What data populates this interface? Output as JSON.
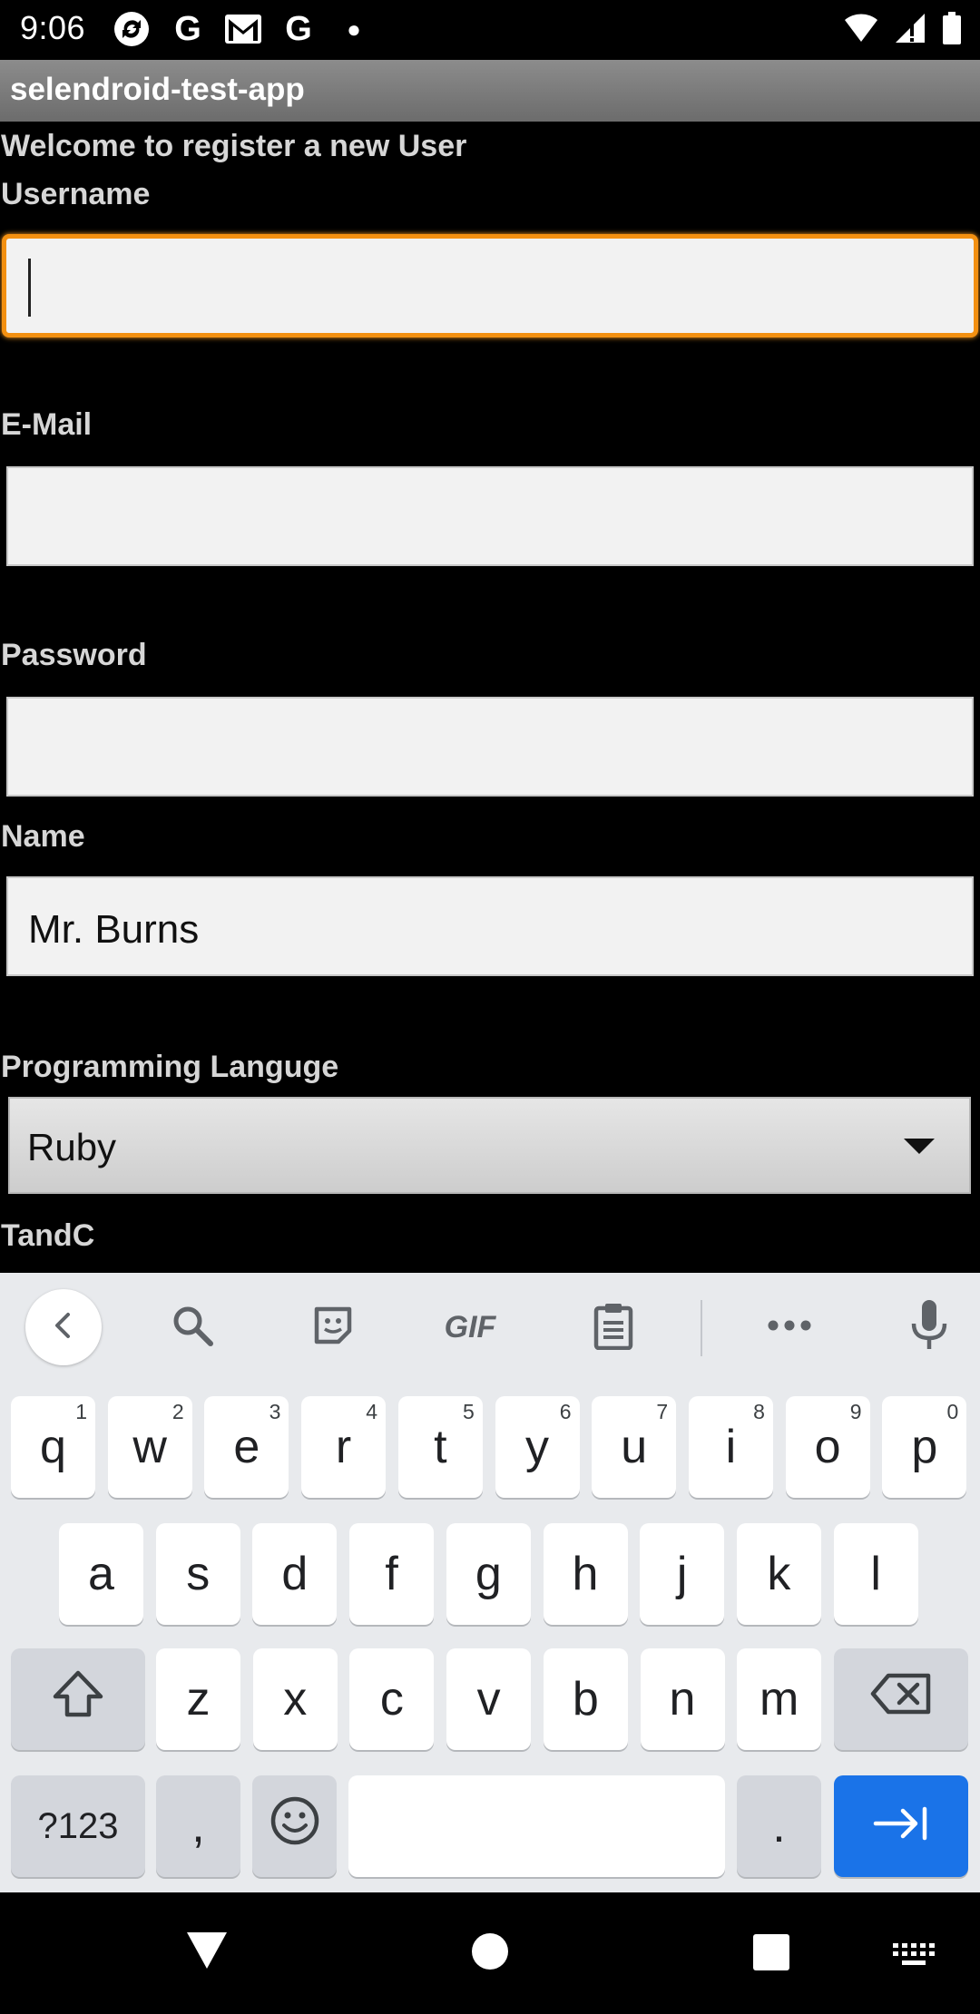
{
  "status_bar": {
    "time": "9:06",
    "notification_icons": [
      "sync-icon",
      "google-icon",
      "gmail-icon",
      "google-icon",
      "dot-icon"
    ],
    "system_icons": [
      "wifi-icon",
      "signal-icon",
      "battery-icon"
    ]
  },
  "app": {
    "title": "selendroid-test-app"
  },
  "form": {
    "heading": "Welcome to register a new User",
    "username_label": "Username",
    "username_value": "",
    "email_label": "E-Mail",
    "email_value": "",
    "password_label": "Password",
    "password_value": "",
    "name_label": "Name",
    "name_value": "Mr. Burns",
    "language_label": "Programming Languge",
    "language_selected": "Ruby",
    "tandc_label": "TandC"
  },
  "keyboard": {
    "toolbar": {
      "gif_label": "GIF"
    },
    "row1": [
      {
        "key": "q",
        "hint": "1"
      },
      {
        "key": "w",
        "hint": "2"
      },
      {
        "key": "e",
        "hint": "3"
      },
      {
        "key": "r",
        "hint": "4"
      },
      {
        "key": "t",
        "hint": "5"
      },
      {
        "key": "y",
        "hint": "6"
      },
      {
        "key": "u",
        "hint": "7"
      },
      {
        "key": "i",
        "hint": "8"
      },
      {
        "key": "o",
        "hint": "9"
      },
      {
        "key": "p",
        "hint": "0"
      }
    ],
    "row2": [
      "a",
      "s",
      "d",
      "f",
      "g",
      "h",
      "j",
      "k",
      "l"
    ],
    "row3": [
      "z",
      "x",
      "c",
      "v",
      "b",
      "n",
      "m"
    ],
    "symbols_label": "?123",
    "comma_label": ",",
    "period_label": "."
  },
  "colors": {
    "focus_border": "#f39011",
    "action_key": "#1a73e8",
    "keyboard_bg": "#e8eaed"
  }
}
